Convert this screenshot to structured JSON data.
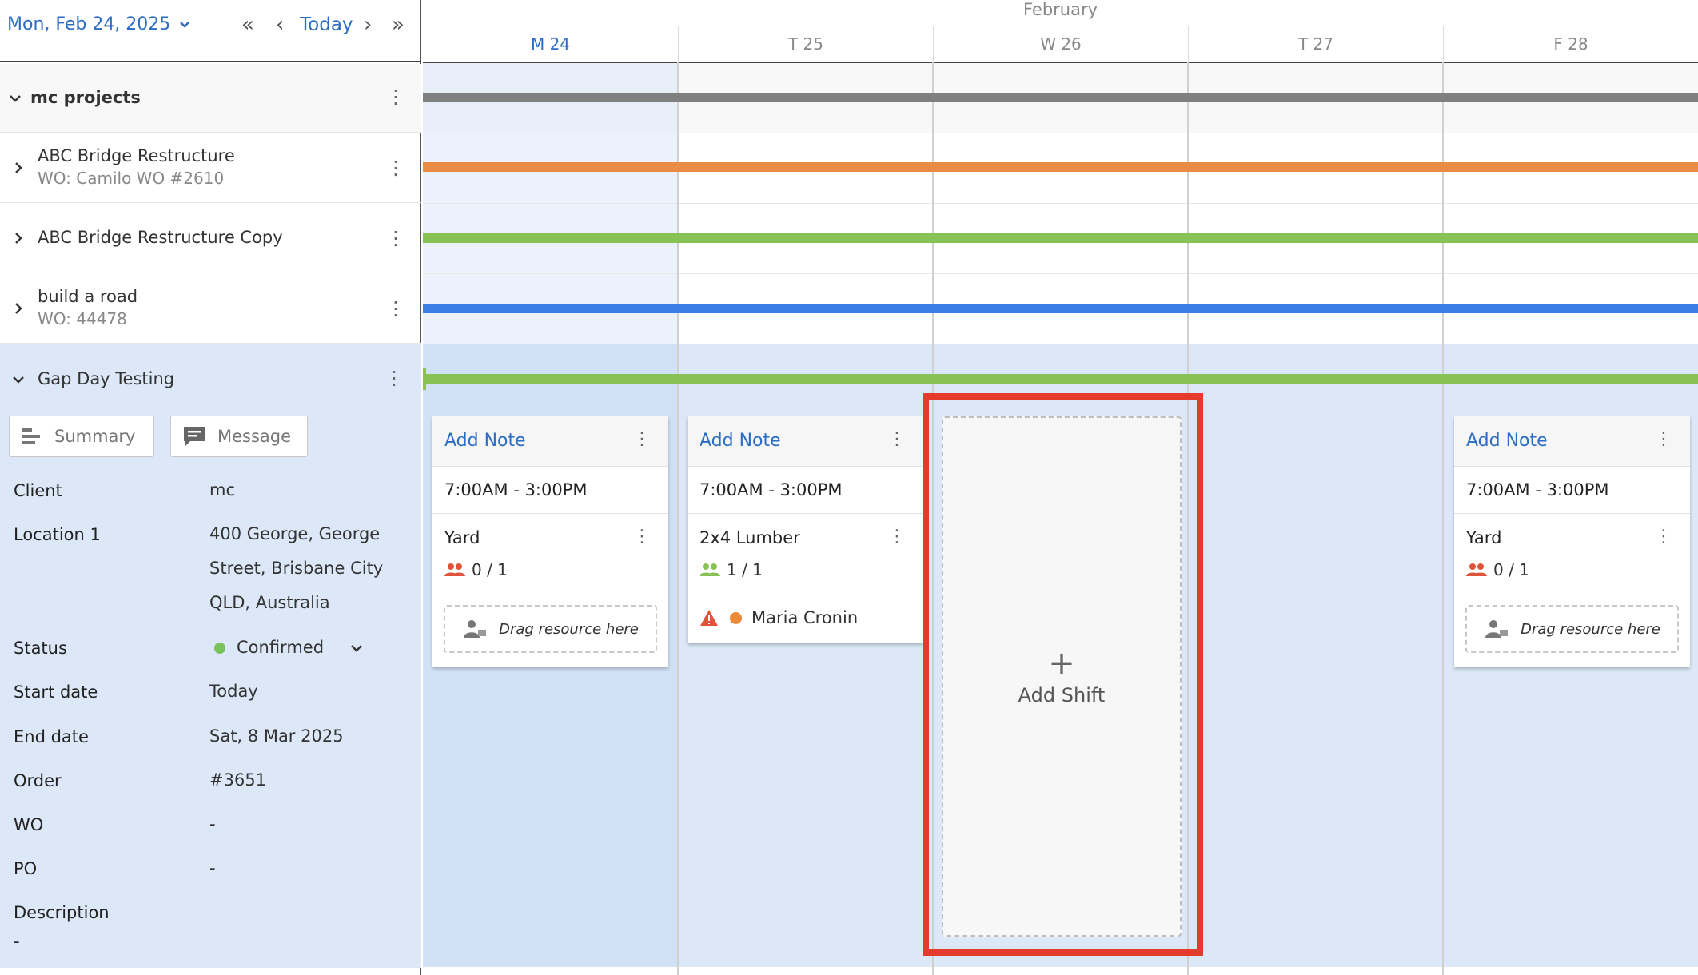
{
  "toolbar": {
    "date_label": "Mon, Feb 24, 2025",
    "today_label": "Today",
    "first_glyph": "«",
    "prev_glyph": "‹",
    "next_glyph": "›",
    "last_glyph": "»"
  },
  "calendar": {
    "month": "February",
    "days": [
      "M 24",
      "T 25",
      "W 26",
      "T 27",
      "F 28"
    ]
  },
  "groups": [
    {
      "title": "mc projects"
    },
    {
      "title": "ABC Bridge Restructure",
      "sub": "WO: Camilo WO #2610"
    },
    {
      "title": "ABC Bridge Restructure Copy"
    },
    {
      "title": "build a road",
      "sub": "WO: 44478"
    },
    {
      "title": "Gap Day Testing"
    }
  ],
  "gap_panel": {
    "summary_label": "Summary",
    "message_label": "Message",
    "fields": {
      "client_label": "Client",
      "client": "mc",
      "location_label": "Location 1",
      "location_lines": [
        "400 George, George",
        "Street, Brisbane City",
        "QLD, Australia"
      ],
      "status_label": "Status",
      "status": "Confirmed",
      "start_label": "Start date",
      "start": "Today",
      "end_label": "End date",
      "end": "Sat, 8 Mar 2025",
      "order_label": "Order",
      "order": "#3651",
      "wo_label": "WO",
      "wo": "-",
      "po_label": "PO",
      "po": "-",
      "desc_label": "Description",
      "desc": "-"
    }
  },
  "cards": [
    {
      "add_note": "Add Note",
      "time": "7:00AM - 3:00PM",
      "job": "Yard",
      "count": "0 / 1",
      "drop": "Drag resource here"
    },
    {
      "add_note": "Add Note",
      "time": "7:00AM - 3:00PM",
      "job": "2x4 Lumber",
      "count": "1 / 1",
      "assignee": "Maria Cronin"
    },
    {
      "add_note": "Add Note",
      "time": "7:00AM - 3:00PM",
      "job": "Yard",
      "count": "0 / 1",
      "drop": "Drag resource here"
    }
  ],
  "add_shift": {
    "plus": "+",
    "label": "Add Shift"
  },
  "colors": {
    "accent": "#2b6cc4",
    "bar_gray": "#7f7f7f",
    "bar_orange": "#ea8c45",
    "bar_green": "#88c255",
    "bar_blue": "#3a7ee6",
    "status_green": "#79c15a",
    "highlight_red": "#e53b2c",
    "warning_red": "#e0533a",
    "assignee_orange": "#ec8a3a"
  }
}
